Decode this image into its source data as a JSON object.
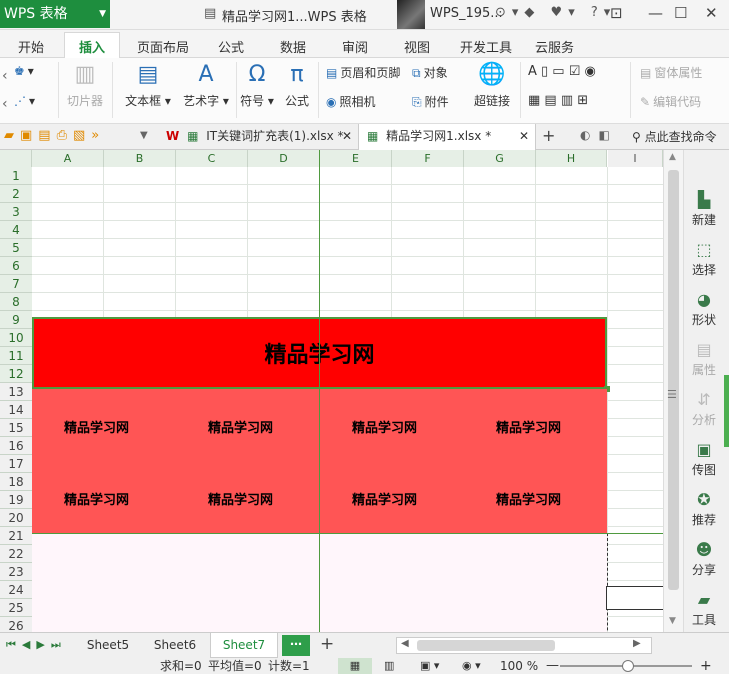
{
  "app": {
    "name": "WPS 表格",
    "doc_title": "精品学习网1...WPS 表格",
    "user": "WPS_195..."
  },
  "tabs": [
    "开始",
    "插入",
    "页面布局",
    "公式",
    "数据",
    "审阅",
    "视图",
    "开发工具",
    "云服务"
  ],
  "ribbon": {
    "cutout": "切片器",
    "textbox": "文本框",
    "art_text": "艺术字",
    "symbol": "符号",
    "formula": "公式",
    "header_footer": "页眉和页脚",
    "object": "对象",
    "camera": "照相机",
    "attachment": "附件",
    "hyperlink": "超链接",
    "form_props": "窗体属性",
    "edit_code": "编辑代码"
  },
  "doc_tabs": {
    "file1": "IT关键词扩充表(1).xlsx *",
    "file2": "精品学习网1.xlsx *",
    "search": "点此查找命令"
  },
  "columns": [
    "A",
    "B",
    "C",
    "D",
    "E",
    "F",
    "G",
    "H",
    "I"
  ],
  "rows": [
    "1",
    "2",
    "3",
    "4",
    "5",
    "6",
    "7",
    "8",
    "9",
    "10",
    "11",
    "12",
    "13",
    "14",
    "15",
    "16",
    "17",
    "18",
    "19",
    "20",
    "21",
    "22",
    "23",
    "24",
    "25",
    "26"
  ],
  "cells": {
    "title": "精品学习网",
    "items": [
      "精品学习网",
      "精品学习网",
      "精品学习网",
      "精品学习网",
      "精品学习网",
      "精品学习网",
      "精品学习网",
      "精品学习网"
    ]
  },
  "sidebar": [
    "新建",
    "选择",
    "形状",
    "属性",
    "分析",
    "传图",
    "推荐",
    "分享",
    "工具"
  ],
  "sheets": [
    "Sheet5",
    "Sheet6",
    "Sheet7"
  ],
  "status": {
    "sum": "求和=0",
    "avg": "平均值=0",
    "count": "计数=1",
    "zoom": "100 %"
  },
  "colors": {
    "title_bg": "#ff0000",
    "block_bg": "#ff5555",
    "accent": "#1e8e3e"
  }
}
